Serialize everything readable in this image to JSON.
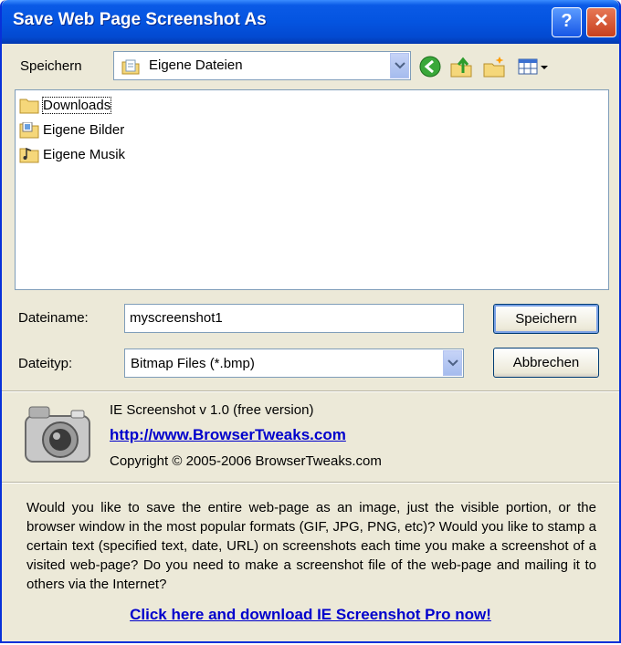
{
  "window": {
    "title": "Save Web Page Screenshot As",
    "help_label": "?",
    "close_label": "✕"
  },
  "save_in": {
    "label": "Speichern",
    "value": "Eigene Dateien"
  },
  "files": [
    {
      "name": "Downloads",
      "icon": "folder-icon"
    },
    {
      "name": "Eigene Bilder",
      "icon": "pictures-folder-icon"
    },
    {
      "name": "Eigene Musik",
      "icon": "music-folder-icon"
    }
  ],
  "filename": {
    "label": "Dateiname:",
    "value": "myscreenshot1"
  },
  "filetype": {
    "label": "Dateityp:",
    "value": "Bitmap Files (*.bmp)"
  },
  "buttons": {
    "save": "Speichern",
    "cancel": "Abbrechen"
  },
  "product": {
    "name": "IE Screenshot v 1.0  (free version)",
    "url": "http://www.BrowserTweaks.com",
    "copyright": "Copyright © 2005-2006  BrowserTweaks.com"
  },
  "promo": {
    "text": "Would you like to save the entire web-page as an image, just the  visible  portion, or the browser window in the most popular formats  (GIF, JPG, PNG, etc)?  Would you like to stamp a certain text  (specified text, date, URL)  on screenshots  each time you make  a  screenshot of  a  visited web-page?  Do  you  need  to make  a screenshot file of the web-page and mailing it to others via the Internet?",
    "link": "Click here and download IE Screenshot Pro now!"
  },
  "colors": {
    "titlebar": "#0454e0",
    "dialog_bg": "#ece9d8",
    "link": "#0000cc"
  }
}
